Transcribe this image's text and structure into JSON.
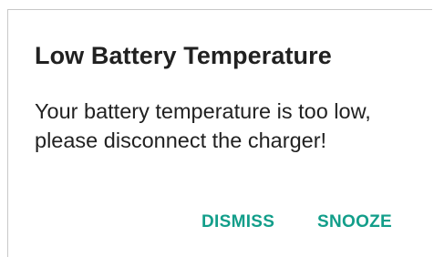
{
  "dialog": {
    "title": "Low Battery Temperature",
    "message": "Your battery temperature is too low, please disconnect the charger!",
    "buttons": {
      "dismiss": "DISMISS",
      "snooze": "SNOOZE"
    },
    "accent_color": "#129e8a"
  }
}
